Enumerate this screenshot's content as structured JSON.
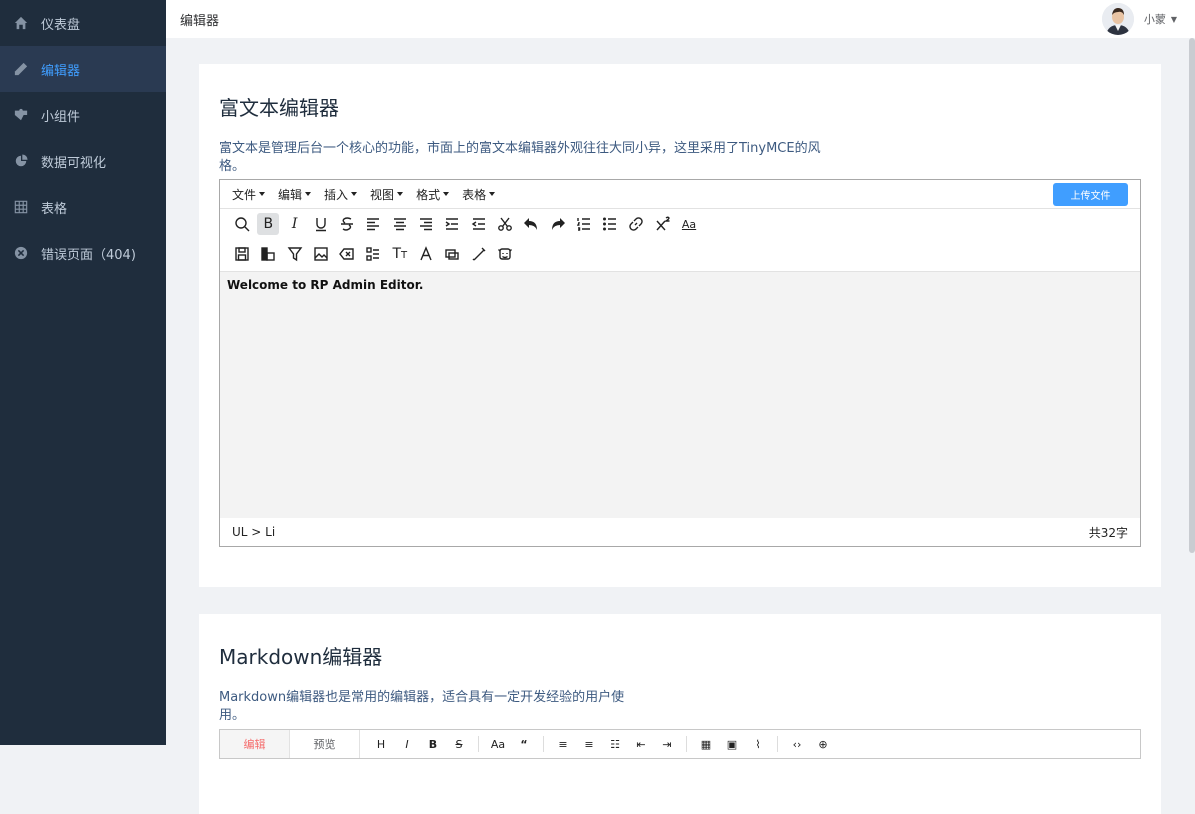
{
  "sidebar": {
    "items": [
      {
        "label": "仪表盘",
        "icon": "home-icon"
      },
      {
        "label": "编辑器",
        "icon": "pencil-icon"
      },
      {
        "label": "小组件",
        "icon": "puzzle-icon"
      },
      {
        "label": "数据可视化",
        "icon": "pie-chart-icon"
      },
      {
        "label": "表格",
        "icon": "grid-icon"
      },
      {
        "label": "错误页面（404)",
        "icon": "close-circle-icon"
      }
    ],
    "active_index": 1
  },
  "header": {
    "breadcrumb": "编辑器",
    "user_name": "小蒙"
  },
  "rich_editor": {
    "title": "富文本编辑器",
    "description": "富文本是管理后台一个核心的功能，市面上的富文本编辑器外观往往大同小异，这里采用了TinyMCE的风格。",
    "menus": [
      "文件",
      "编辑",
      "插入",
      "视图",
      "格式",
      "表格"
    ],
    "upload_label": "上传文件",
    "content_text": "Welcome to RP Admin Editor.",
    "status_path": "UL > Li",
    "word_count": "共32字",
    "toolbar_row1_icons": [
      "search-icon",
      "bold-icon",
      "italic-icon",
      "underline-icon",
      "strikethrough-icon",
      "align-left-icon",
      "align-center-icon",
      "align-right-icon",
      "indent-icon",
      "outdent-icon",
      "cut-icon",
      "undo-icon",
      "redo-icon",
      "ordered-list-icon",
      "unordered-list-icon",
      "link-icon",
      "superscript-icon",
      "font-size-icon"
    ],
    "toolbar_row2_icons": [
      "save-icon",
      "template-icon",
      "filter-icon",
      "image-icon",
      "clear-format-icon",
      "checklist-icon",
      "text-style-icon",
      "font-color-icon",
      "copy-icon",
      "wand-icon",
      "emoji-icon"
    ]
  },
  "markdown_editor": {
    "title": "Markdown编辑器",
    "description": "Markdown编辑器也是常用的编辑器，适合具有一定开发经验的用户使用。",
    "tab_edit": "编辑",
    "tab_preview": "预览"
  },
  "colors": {
    "accent": "#409eff",
    "sidebar_bg": "#1f2d3d",
    "active_tab": "#f56c6c"
  }
}
